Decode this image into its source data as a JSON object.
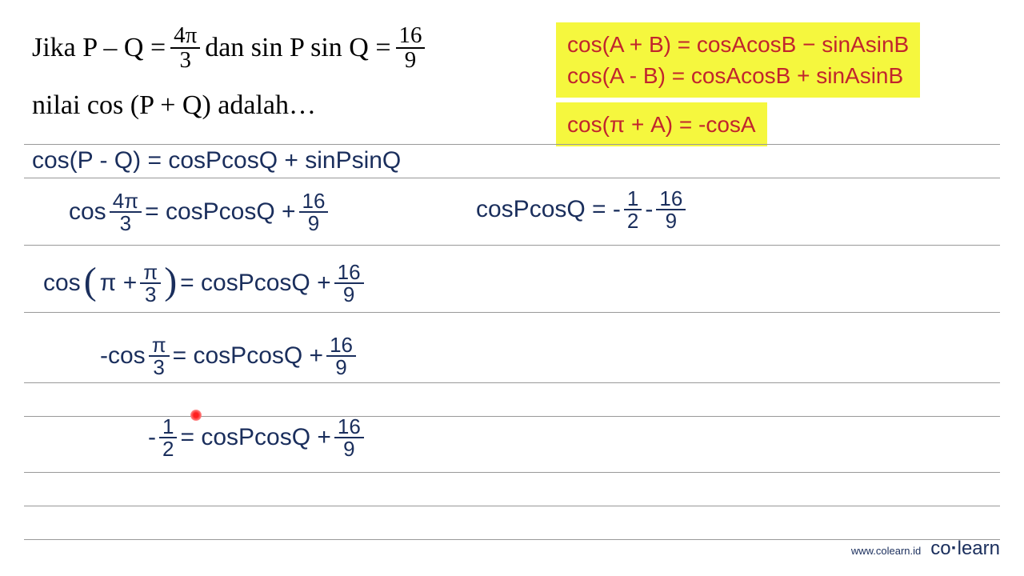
{
  "problem": {
    "prefix": "Jika P – Q =",
    "frac1_num": "4π",
    "frac1_den": "3",
    "mid": "dan sin P sin Q =",
    "frac2_num": "16",
    "frac2_den": "9",
    "line2": "nilai cos (P + Q) adalah…"
  },
  "formula_box1_line1": "cos(A + B) = cosAcosB − sinAsinB",
  "formula_box1_line2": "cos(A - B) = cosAcosB + sinAsinB",
  "formula_box2": "cos(π + A) = -cosA",
  "eq1": "cos(P - Q) = cosPcosQ + sinPsinQ",
  "eq2": {
    "lhs": "cos",
    "f1n": "4π",
    "f1d": "3",
    "mid": "= cosPcosQ +",
    "f2n": "16",
    "f2d": "9"
  },
  "eq2b": {
    "lhs": "cosPcosQ = -",
    "f1n": "1",
    "f1d": "2",
    "mid": "-",
    "f2n": "16",
    "f2d": "9"
  },
  "eq3": {
    "lhs": "cos",
    "pi": "π +",
    "f1n": "π",
    "f1d": "3",
    "mid": "= cosPcosQ +",
    "f2n": "16",
    "f2d": "9"
  },
  "eq4": {
    "lhs": "-cos",
    "f1n": "π",
    "f1d": "3",
    "mid": "= cosPcosQ +",
    "f2n": "16",
    "f2d": "9"
  },
  "eq5": {
    "lhs": "-",
    "f1n": "1",
    "f1d": "2",
    "mid": "= cosPcosQ +",
    "f2n": "16",
    "f2d": "9"
  },
  "footer": {
    "url": "www.colearn.id",
    "brand_pre": "co",
    "brand_dot": "·",
    "brand_post": "learn"
  }
}
